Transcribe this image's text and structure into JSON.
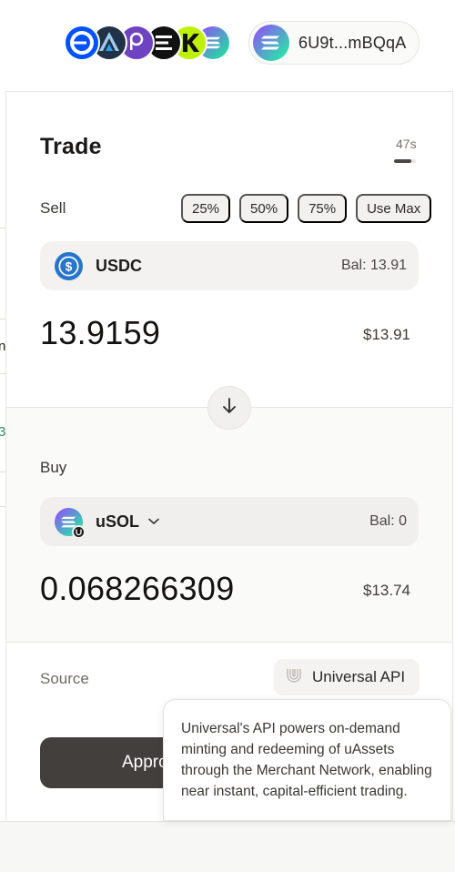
{
  "header": {
    "chain_icons": [
      "base-icon",
      "arbitrum-icon",
      "polkadot-icon",
      "ethena-icon",
      "kaia-icon",
      "solana-icon"
    ],
    "wallet": {
      "address": "6U9t...mBQqA",
      "avatar_icon": "solana-icon"
    }
  },
  "left_edge_fragments": [
    "n",
    "3"
  ],
  "trade": {
    "title": "Trade",
    "timer": "47s",
    "timer_progress": 0.8,
    "sell": {
      "label": "Sell",
      "percent_buttons": [
        "25%",
        "50%",
        "75%",
        "Use Max"
      ],
      "token": {
        "symbol": "USDC",
        "icon": "usdc-icon",
        "balance": "Bal: 13.91"
      },
      "amount": "13.9159",
      "usd_value": "$13.91"
    },
    "swap_icon": "arrow-down-icon",
    "buy": {
      "label": "Buy",
      "token": {
        "symbol": "uSOL",
        "icon": "usol-icon",
        "badge_icon": "universal-badge-icon",
        "balance": "Bal: 0",
        "dropdown_icon": "chevron-down-icon"
      },
      "amount": "0.068266309",
      "usd_value": "$13.74"
    },
    "source": {
      "label": "Source",
      "provider": "Universal API",
      "provider_icon": "universal-logo-icon"
    },
    "approve_label": "Appro",
    "tooltip": "Universal's API powers on-demand minting and redeeming of uAssets through the Merchant Network, enabling near instant, capital-efficient trading."
  },
  "colors": {
    "usdc_blue": "#2775ca",
    "approve_button": "#433f3c",
    "text_primary": "#1a1918"
  }
}
